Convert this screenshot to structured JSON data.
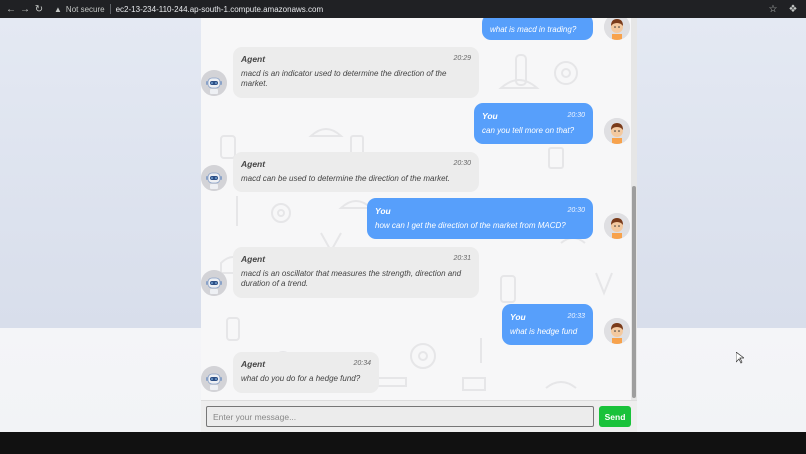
{
  "browser": {
    "not_secure": "Not secure",
    "url": "ec2-13-234-110-244.ap-south-1.compute.amazonaws.com"
  },
  "chat": {
    "messages": [
      {
        "sender": "user",
        "name": "",
        "time": "",
        "text": "what is macd in trading?"
      },
      {
        "sender": "agent",
        "name": "Agent",
        "time": "20:29",
        "text": "macd is an indicator used to determine the direction of the market."
      },
      {
        "sender": "user",
        "name": "You",
        "time": "20:30",
        "text": "can you tell more on that?"
      },
      {
        "sender": "agent",
        "name": "Agent",
        "time": "20:30",
        "text": "macd can be used to determine the direction of the market."
      },
      {
        "sender": "user",
        "name": "You",
        "time": "20:30",
        "text": "how can I get the direction of the market from MACD?"
      },
      {
        "sender": "agent",
        "name": "Agent",
        "time": "20:31",
        "text": "macd is an oscillator that measures the strength, direction and duration of a trend."
      },
      {
        "sender": "user",
        "name": "You",
        "time": "20:33",
        "text": "what is hedge fund"
      },
      {
        "sender": "agent",
        "name": "Agent",
        "time": "20:34",
        "text": "what do you do for a hedge fund?"
      }
    ]
  },
  "composer": {
    "placeholder": "Enter your message...",
    "send_label": "Send"
  },
  "colors": {
    "user_bubble": "#579ffb",
    "agent_bubble": "#ececec",
    "send_button": "#19c23a"
  },
  "icons": [
    "back-arrow-icon",
    "forward-arrow-icon",
    "reload-icon",
    "warning-icon",
    "star-icon",
    "extensions-icon",
    "robot-avatar-icon",
    "user-avatar-icon",
    "mouse-cursor-icon"
  ]
}
